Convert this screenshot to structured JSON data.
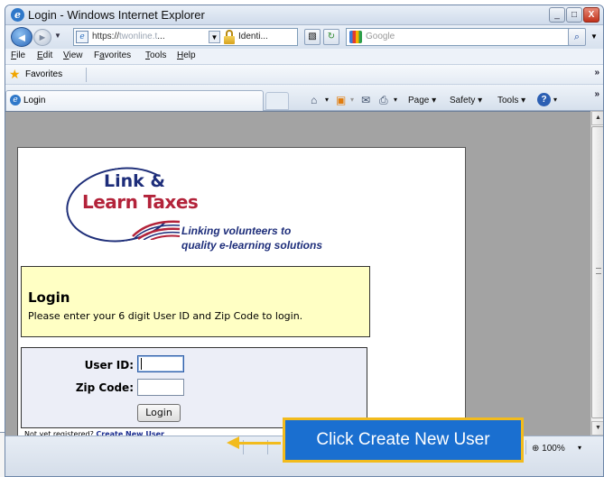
{
  "window": {
    "title": "Login - Windows Internet Explorer",
    "buttons": {
      "minimize": "_",
      "maximize": "□",
      "close": "X"
    }
  },
  "addressbar": {
    "url_prefix": "https://",
    "url_host": "twonline.t",
    "url_ellipsis": "...",
    "identity_label": "Identi..."
  },
  "search": {
    "placeholder": "Google"
  },
  "menu": {
    "items": [
      {
        "label": "File",
        "key": "F",
        "rest": "ile"
      },
      {
        "label": "Edit",
        "key": "E",
        "rest": "dit"
      },
      {
        "label": "View",
        "key": "V",
        "rest": "iew"
      },
      {
        "label": "Favorites",
        "key": "a",
        "prefix": "F",
        "rest": "vorites"
      },
      {
        "label": "Tools",
        "key": "T",
        "rest": "ools"
      },
      {
        "label": "Help",
        "key": "H",
        "rest": "elp"
      }
    ]
  },
  "favorites": {
    "label": "Favorites",
    "chevron": "»"
  },
  "tab": {
    "label": "Login"
  },
  "commands": {
    "page": "Page",
    "safety": "Safety",
    "tools": "Tools",
    "chevron": "»"
  },
  "logo": {
    "line1": "Link &",
    "line2": "Learn Taxes",
    "tagline1": "Linking volunteers to",
    "tagline2": "quality e-learning solutions"
  },
  "login": {
    "heading": "Login",
    "instructions": "Please enter your 6 digit User ID and Zip Code to login."
  },
  "form": {
    "userid_label": "User ID:",
    "userid_value": "",
    "zip_label": "Zip Code:",
    "zip_value": "",
    "submit_label": "Login"
  },
  "registration": {
    "prompt": "Not yet registered?",
    "link": "Create New User"
  },
  "statusbar": {
    "zoom": "100%"
  },
  "annotation": {
    "callout": "Click Create New User"
  },
  "colors": {
    "login_box_bg": "#ffffc4",
    "form_box_bg": "#eceef7",
    "callout_bg": "#1a6fd0",
    "callout_border": "#f2bb1d",
    "link": "#1b2d8f"
  }
}
